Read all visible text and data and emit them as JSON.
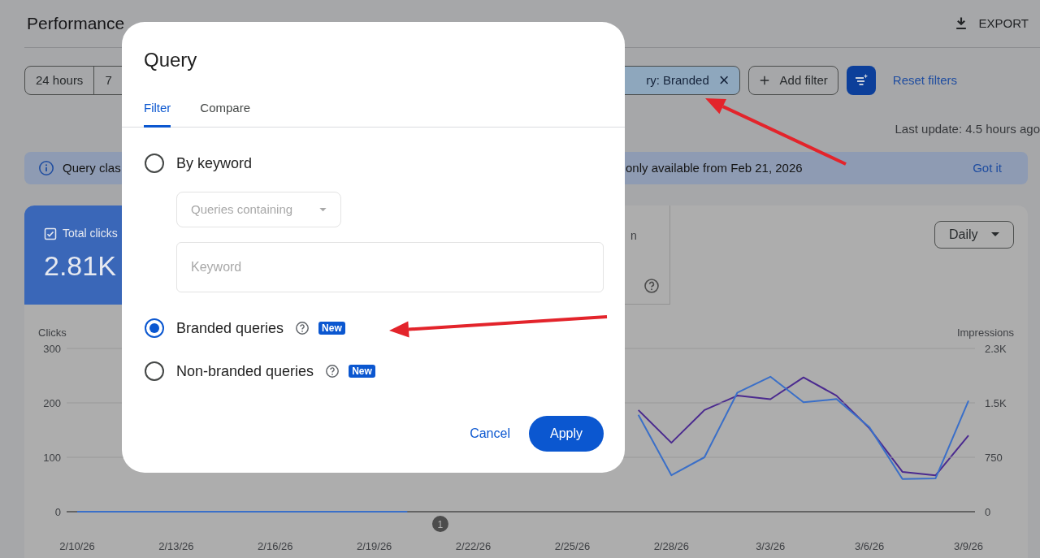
{
  "page": {
    "title": "Performance",
    "export_label": "EXPORT"
  },
  "date_ranges": [
    {
      "label": "24 hours"
    },
    {
      "label": "7"
    }
  ],
  "filters": {
    "active_chip": "ry: Branded",
    "chip_close": "×",
    "add_filter": "Add filter",
    "reset": "Reset filters"
  },
  "last_update": "Last update: 4.5 hours ago",
  "banner": {
    "text_start": "Query clas",
    "text_end": "only available from Feb 21, 2026",
    "action": "Got it"
  },
  "metrics": [
    {
      "label": "Total clicks",
      "value": "2.81K",
      "checked": true
    },
    {
      "label": "n",
      "checked": false
    }
  ],
  "granularity": "Daily",
  "chart": {
    "clicks": {
      "chart_data": {
        "type": "line",
        "categories": [
          "2/10/26",
          null,
          null,
          "2/13/26",
          null,
          null,
          "2/16/26",
          null,
          null,
          "2/19/26",
          null,
          null,
          "2/22/26",
          null,
          null,
          "2/25/26",
          null,
          null,
          "2/28/26",
          null,
          null,
          "3/3/26",
          null,
          null,
          "3/6/26",
          null,
          null,
          "3/9/26"
        ],
        "ylim": [
          0,
          300
        ],
        "yticks": [
          0,
          100,
          200,
          300
        ],
        "series": [
          {
            "name": "Clicks",
            "color": "#3a6fc8",
            "values": [
              0,
              0,
              0,
              0,
              0,
              0,
              0,
              0,
              0,
              0,
              0,
              null,
              null,
              null,
              null,
              null,
              null,
              178,
              67,
              100,
              219,
              248,
              201,
              207,
              155,
              60,
              61,
              204
            ]
          }
        ],
        "annotations": [
          "1"
        ]
      }
    },
    "impressions": {
      "chart_data": {
        "type": "line",
        "categories": [
          null,
          null,
          null,
          null,
          null,
          null,
          null,
          null,
          null,
          null,
          null,
          null,
          null,
          null,
          null,
          null,
          null,
          null,
          null,
          null,
          null,
          null,
          null,
          null,
          null,
          null,
          null,
          null
        ],
        "ylim": [
          0,
          2250
        ],
        "yticks": [
          0,
          750,
          {
            "value": 1500,
            "label": "1.5K"
          },
          {
            "value": 2250,
            "label": "2.3K"
          }
        ],
        "series": [
          {
            "name": "Impressions",
            "color": "#4b2a8f",
            "values": [
              null,
              null,
              null,
              null,
              null,
              null,
              null,
              null,
              null,
              null,
              null,
              null,
              null,
              null,
              null,
              null,
              null,
              1400,
              950,
              1400,
              1600,
              1550,
              1850,
              1600,
              1150,
              550,
              500,
              1050
            ]
          }
        ]
      }
    }
  },
  "dialog": {
    "title": "Query",
    "tabs": [
      {
        "label": "Filter",
        "selected": true
      },
      {
        "label": "Compare",
        "selected": false
      }
    ],
    "options": [
      {
        "kind": "keyword",
        "label": "By keyword",
        "selected": false,
        "dropdown_placeholder": "Queries containing",
        "placeholder": "Keyword"
      },
      {
        "kind": "preset",
        "label": "Branded queries",
        "selected": true,
        "badge": "New"
      },
      {
        "kind": "preset",
        "label": "Non-branded queries",
        "selected": false,
        "badge": "New"
      }
    ],
    "buttons": [
      {
        "kind": "text",
        "label": "Cancel"
      },
      {
        "kind": "filled",
        "label": "Apply"
      }
    ]
  }
}
